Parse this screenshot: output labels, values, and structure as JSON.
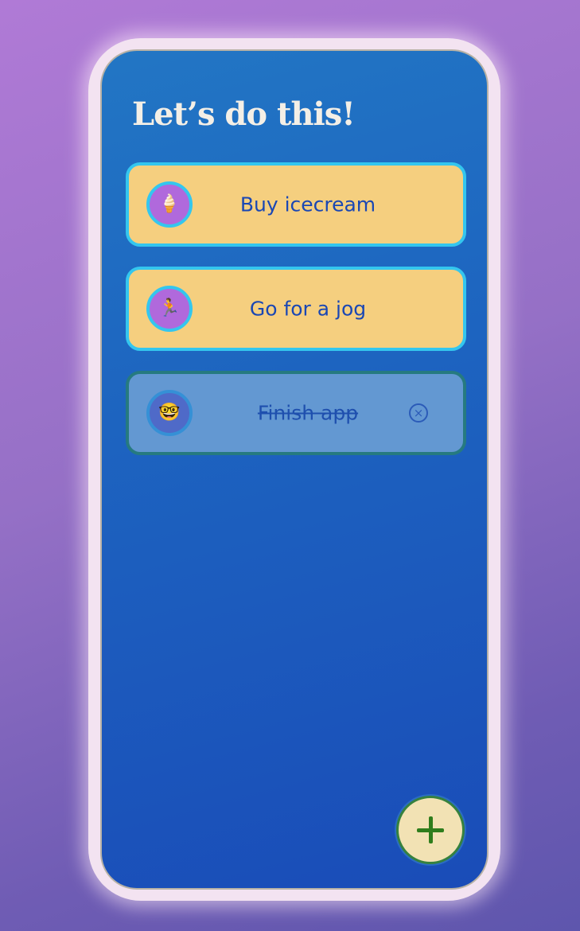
{
  "app": {
    "title": "Let’s do this!"
  },
  "todos": [
    {
      "label": "Buy icecream",
      "icon": "ice-cream-icon",
      "glyph": "🍦",
      "status": "active"
    },
    {
      "label": "Go for a jog",
      "icon": "runner-icon",
      "glyph": "🏃",
      "status": "active"
    },
    {
      "label": "Finish app",
      "icon": "nerd-face-icon",
      "glyph": "🤓",
      "status": "done"
    }
  ],
  "delete_button": {
    "icon": "close-circle-icon",
    "glyph": "×"
  },
  "add_button": {
    "icon": "plus-icon"
  },
  "colors": {
    "screen_background": "#1d64c0",
    "active_card": "#f5cf7f",
    "active_border": "#34c6ee",
    "done_card": "#6398d2",
    "done_border": "#267a80",
    "avatar_background": "#b069dc",
    "label_text": "#1a47b4",
    "fab_background": "#f2e2b4",
    "fab_plus": "#2f7d1c"
  }
}
